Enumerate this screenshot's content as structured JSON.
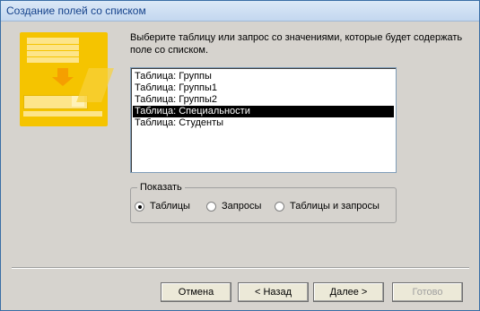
{
  "window": {
    "title": "Создание полей со списком"
  },
  "prompt": "Выберите таблицу или запрос со значениями, которые будет содержать поле со списком.",
  "list": {
    "items": [
      "Таблица: Группы",
      "Таблица: Группы1",
      "Таблица: Группы2",
      "Таблица: Специальности",
      "Таблица: Студенты"
    ],
    "selected_index": 3
  },
  "show_group": {
    "legend": "Показать",
    "options": [
      "Таблицы",
      "Запросы",
      "Таблицы и запросы"
    ],
    "selected": "Таблицы"
  },
  "buttons": {
    "cancel": "Отмена",
    "back": "< Назад",
    "next": "Далее >",
    "finish": "Готово"
  }
}
